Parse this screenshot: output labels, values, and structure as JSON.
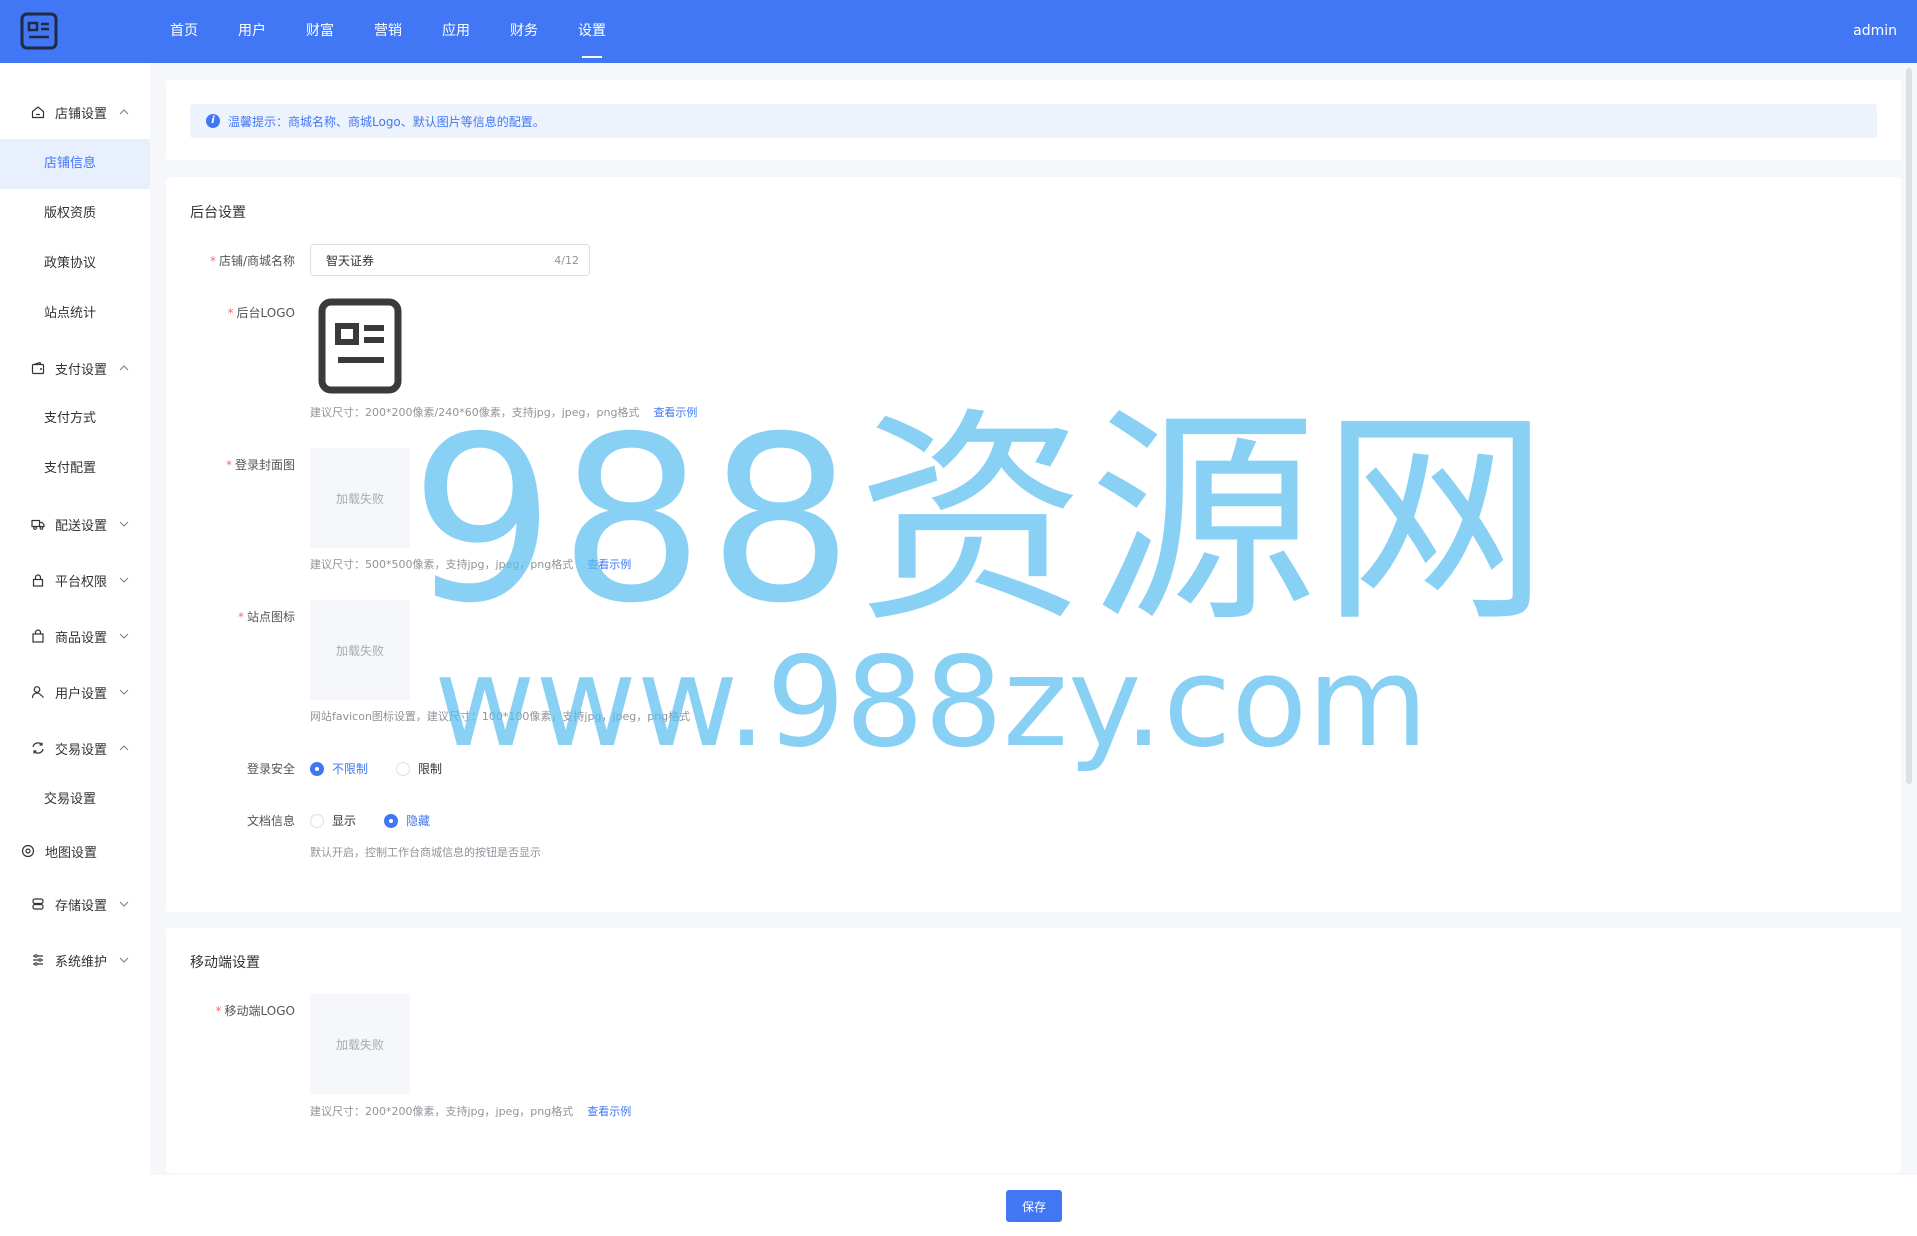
{
  "colors": {
    "primary": "#4177f5",
    "required": "#f56c6c"
  },
  "header": {
    "logo_icon": "id-card-icon",
    "nav": [
      "首页",
      "用户",
      "财富",
      "营销",
      "应用",
      "财务",
      "设置"
    ],
    "active_nav": "设置",
    "user": "admin"
  },
  "sidebar": {
    "groups": [
      {
        "label": "店铺设置",
        "icon": "home-icon",
        "expanded": true,
        "items": [
          "店铺信息",
          "版权资质",
          "政策协议",
          "站点统计"
        ]
      },
      {
        "label": "支付设置",
        "icon": "wallet-icon",
        "expanded": true,
        "items": [
          "支付方式",
          "支付配置"
        ]
      },
      {
        "label": "配送设置",
        "icon": "truck-icon",
        "expanded": false
      },
      {
        "label": "平台权限",
        "icon": "lock-icon",
        "expanded": false
      },
      {
        "label": "商品设置",
        "icon": "shopping-bag-icon",
        "expanded": false
      },
      {
        "label": "用户设置",
        "icon": "user-icon",
        "expanded": false
      },
      {
        "label": "交易设置",
        "icon": "exchange-icon",
        "expanded": true,
        "items": [
          "交易设置"
        ]
      },
      {
        "label": "地图设置",
        "icon": "location-icon"
      },
      {
        "label": "存储设置",
        "icon": "storage-icon",
        "expanded": false
      },
      {
        "label": "系统维护",
        "icon": "list-settings-icon",
        "expanded": false
      }
    ],
    "active_item": "店铺信息"
  },
  "tip": {
    "icon": "info-icon",
    "text": "温馨提示：商城名称、商城Logo、默认图片等信息的配置。"
  },
  "backend": {
    "title": "后台设置",
    "store_name": {
      "label": "店铺/商城名称",
      "value": "智天证券",
      "count": "4/12"
    },
    "logo": {
      "label": "后台LOGO",
      "hint": "建议尺寸：200*200像素/240*60像素，支持jpg，jpeg，png格式",
      "link": "查看示例"
    },
    "login_cover": {
      "label": "登录封面图",
      "placeholder": "加载失败",
      "hint": "建议尺寸：500*500像素，支持jpg，jpeg，png格式",
      "link": "查看示例"
    },
    "site_icon": {
      "label": "站点图标",
      "placeholder": "加载失败",
      "hint": "网站favicon图标设置，建议尺寸：100*100像素，支持jpg，jpeg，png格式"
    },
    "login_security": {
      "label": "登录安全",
      "options": [
        "不限制",
        "限制"
      ],
      "selected": "不限制"
    },
    "doc_info": {
      "label": "文档信息",
      "options": [
        "显示",
        "隐藏"
      ],
      "selected": "隐藏",
      "hint": "默认开启，控制工作台商城信息的按钮是否显示"
    }
  },
  "mobile": {
    "title": "移动端设置",
    "logo": {
      "label": "移动端LOGO",
      "placeholder": "加载失败",
      "hint": "建议尺寸：200*200像素，支持jpg，jpeg，png格式",
      "link": "查看示例"
    }
  },
  "footer": {
    "save_label": "保存"
  },
  "watermark": {
    "main": "988资源网",
    "url": "www.988zy.com"
  }
}
